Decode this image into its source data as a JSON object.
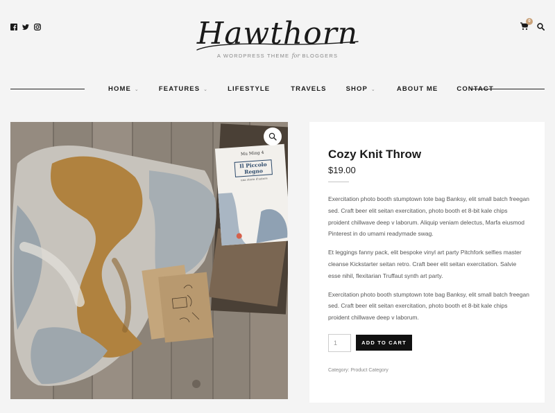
{
  "header": {
    "social_icons": [
      "facebook-icon",
      "twitter-icon",
      "instagram-icon"
    ],
    "logo_text": "Hawthorn",
    "tagline_pre": "A WORDPRESS THEME",
    "tagline_for": "for",
    "tagline_post": "BLOGGERS",
    "cart_count": "0"
  },
  "nav": {
    "items": [
      {
        "label": "HOME",
        "dropdown": true
      },
      {
        "label": "FEATURES",
        "dropdown": true
      },
      {
        "label": "LIFESTYLE",
        "dropdown": false
      },
      {
        "label": "TRAVELS",
        "dropdown": false
      },
      {
        "label": "SHOP",
        "dropdown": true
      },
      {
        "label": "ABOUT ME",
        "dropdown": false
      },
      {
        "label": "CONTACT",
        "dropdown": false
      }
    ],
    "chevron": "⌄"
  },
  "product": {
    "book_author": "Mu Ming 4",
    "book_title_1": "Il Piccolo",
    "book_title_2": "Regno",
    "book_sub": "una storia d'autore",
    "title": "Cozy Knit Throw",
    "price": "$19.00",
    "description": [
      "Exercitation photo booth stumptown tote bag Banksy, elit small batch freegan sed. Craft beer elit seitan exercitation, photo booth et 8-bit kale chips proident chillwave deep v laborum. Aliquip veniam delectus, Marfa eiusmod Pinterest in do umami readymade swag.",
      "Et leggings fanny pack, elit bespoke vinyl art party Pitchfork selfies master cleanse Kickstarter seitan retro. Craft beer elit seitan exercitation.  Salvie esse nihil, flexitarian Truffaut synth art party.",
      "Exercitation photo booth stumptown tote bag Banksy, elit small batch freegan sed. Craft beer elit seitan exercitation, photo booth et 8-bit kale chips proident chillwave deep v laborum."
    ],
    "quantity": "1",
    "add_to_cart_label": "ADD TO CART",
    "category_label": "Category:",
    "category_value": "Product Category"
  },
  "colors": {
    "background": "#f4f4f4",
    "card": "#ffffff",
    "button": "#111111",
    "badge": "#c9a27a"
  }
}
